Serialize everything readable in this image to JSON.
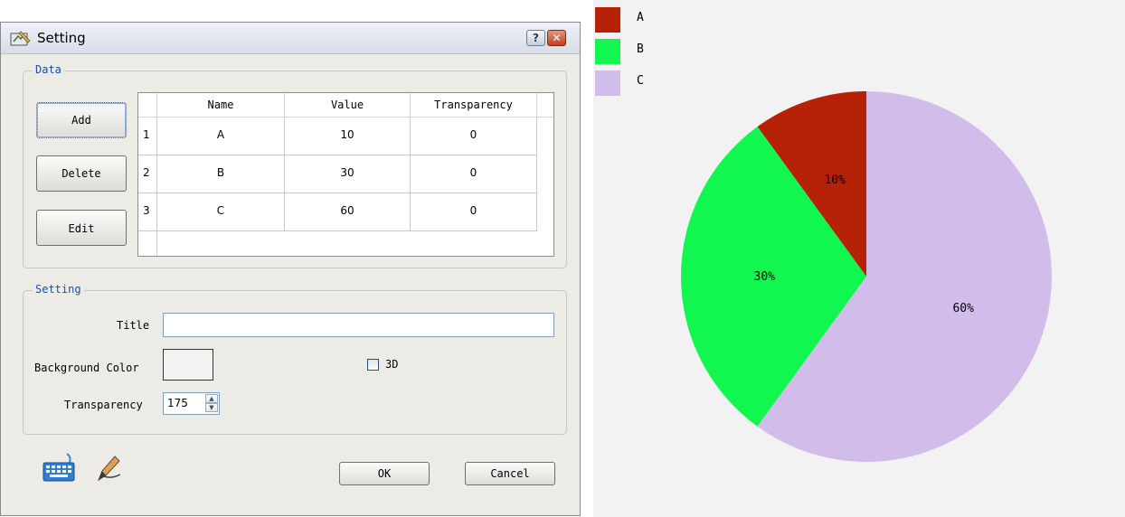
{
  "dialog": {
    "title": "Setting",
    "help_button": "?",
    "close_button": "✕",
    "data_group": {
      "label": "Data",
      "add_button": "Add",
      "delete_button": "Delete",
      "edit_button": "Edit",
      "table": {
        "headers": [
          "Name",
          "Value",
          "Transparency"
        ],
        "rows": [
          {
            "index": "1",
            "name": "A",
            "value": "10",
            "transparency": "0"
          },
          {
            "index": "2",
            "name": "B",
            "value": "30",
            "transparency": "0"
          },
          {
            "index": "3",
            "name": "C",
            "value": "60",
            "transparency": "0"
          }
        ]
      }
    },
    "setting_group": {
      "label": "Setting",
      "title_label": "Title",
      "title_value": "",
      "background_color_label": "Background Color",
      "background_color_value": "#f2f2f2",
      "checkbox_3d_label": "3D",
      "checkbox_3d_checked": false,
      "transparency_label": "Transparency",
      "transparency_value": "175"
    },
    "ok_button": "OK",
    "cancel_button": "Cancel",
    "footer_icons": [
      "keyboard-icon",
      "pen-icon"
    ]
  },
  "chart_data": {
    "type": "pie",
    "title": "",
    "categories": [
      "A",
      "B",
      "C"
    ],
    "values": [
      10,
      30,
      60
    ],
    "labels": [
      "10%",
      "30%",
      "60%"
    ],
    "colors": [
      "#b52208",
      "#11f74f",
      "#d2bdea"
    ],
    "legend_placement": "top-left",
    "start_angle": "12 o'clock",
    "direction": "counterclockwise"
  }
}
